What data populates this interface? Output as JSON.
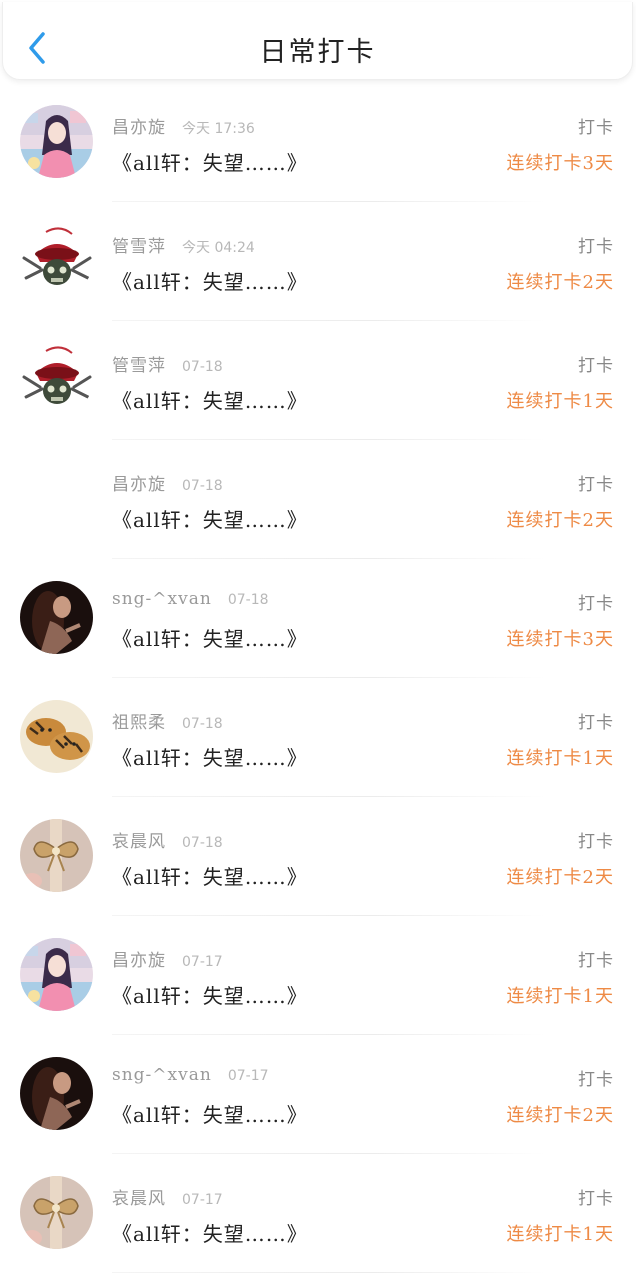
{
  "header": {
    "title": "日常打卡"
  },
  "items": [
    {
      "name": "昌亦旋",
      "time": "今天  17:36",
      "title": "《all轩：失望……》",
      "action": "打卡",
      "streak": "连续打卡3天",
      "avatar": "anime-girl"
    },
    {
      "name": "管雪萍",
      "time": "今天  04:24",
      "title": "《all轩：失望……》",
      "action": "打卡",
      "streak": "连续打卡2天",
      "avatar": "skull"
    },
    {
      "name": "管雪萍",
      "time": "07-18",
      "title": "《all轩：失望……》",
      "action": "打卡",
      "streak": "连续打卡1天",
      "avatar": "skull"
    },
    {
      "name": "昌亦旋",
      "time": "07-18",
      "title": "《all轩：失望……》",
      "action": "打卡",
      "streak": "连续打卡2天",
      "avatar": "none"
    },
    {
      "name": "sng-^xvan",
      "time": "07-18",
      "title": "《all轩：失望……》",
      "action": "打卡",
      "streak": "连续打卡3天",
      "avatar": "dark-portrait"
    },
    {
      "name": "祖熙柔",
      "time": "07-18",
      "title": "《all轩：失望……》",
      "action": "打卡",
      "streak": "连续打卡1天",
      "avatar": "tigers"
    },
    {
      "name": "哀晨风",
      "time": "07-18",
      "title": "《all轩：失望……》",
      "action": "打卡",
      "streak": "连续打卡2天",
      "avatar": "bow"
    },
    {
      "name": "昌亦旋",
      "time": "07-17",
      "title": "《all轩：失望……》",
      "action": "打卡",
      "streak": "连续打卡1天",
      "avatar": "anime-girl"
    },
    {
      "name": "sng-^xvan",
      "time": "07-17",
      "title": "《all轩：失望……》",
      "action": "打卡",
      "streak": "连续打卡2天",
      "avatar": "dark-portrait"
    },
    {
      "name": "哀晨风",
      "time": "07-17",
      "title": "《all轩：失望……》",
      "action": "打卡",
      "streak": "连续打卡1天",
      "avatar": "bow"
    }
  ],
  "colors": {
    "accent": "#2f9bea",
    "streak": "#ee8a45"
  }
}
